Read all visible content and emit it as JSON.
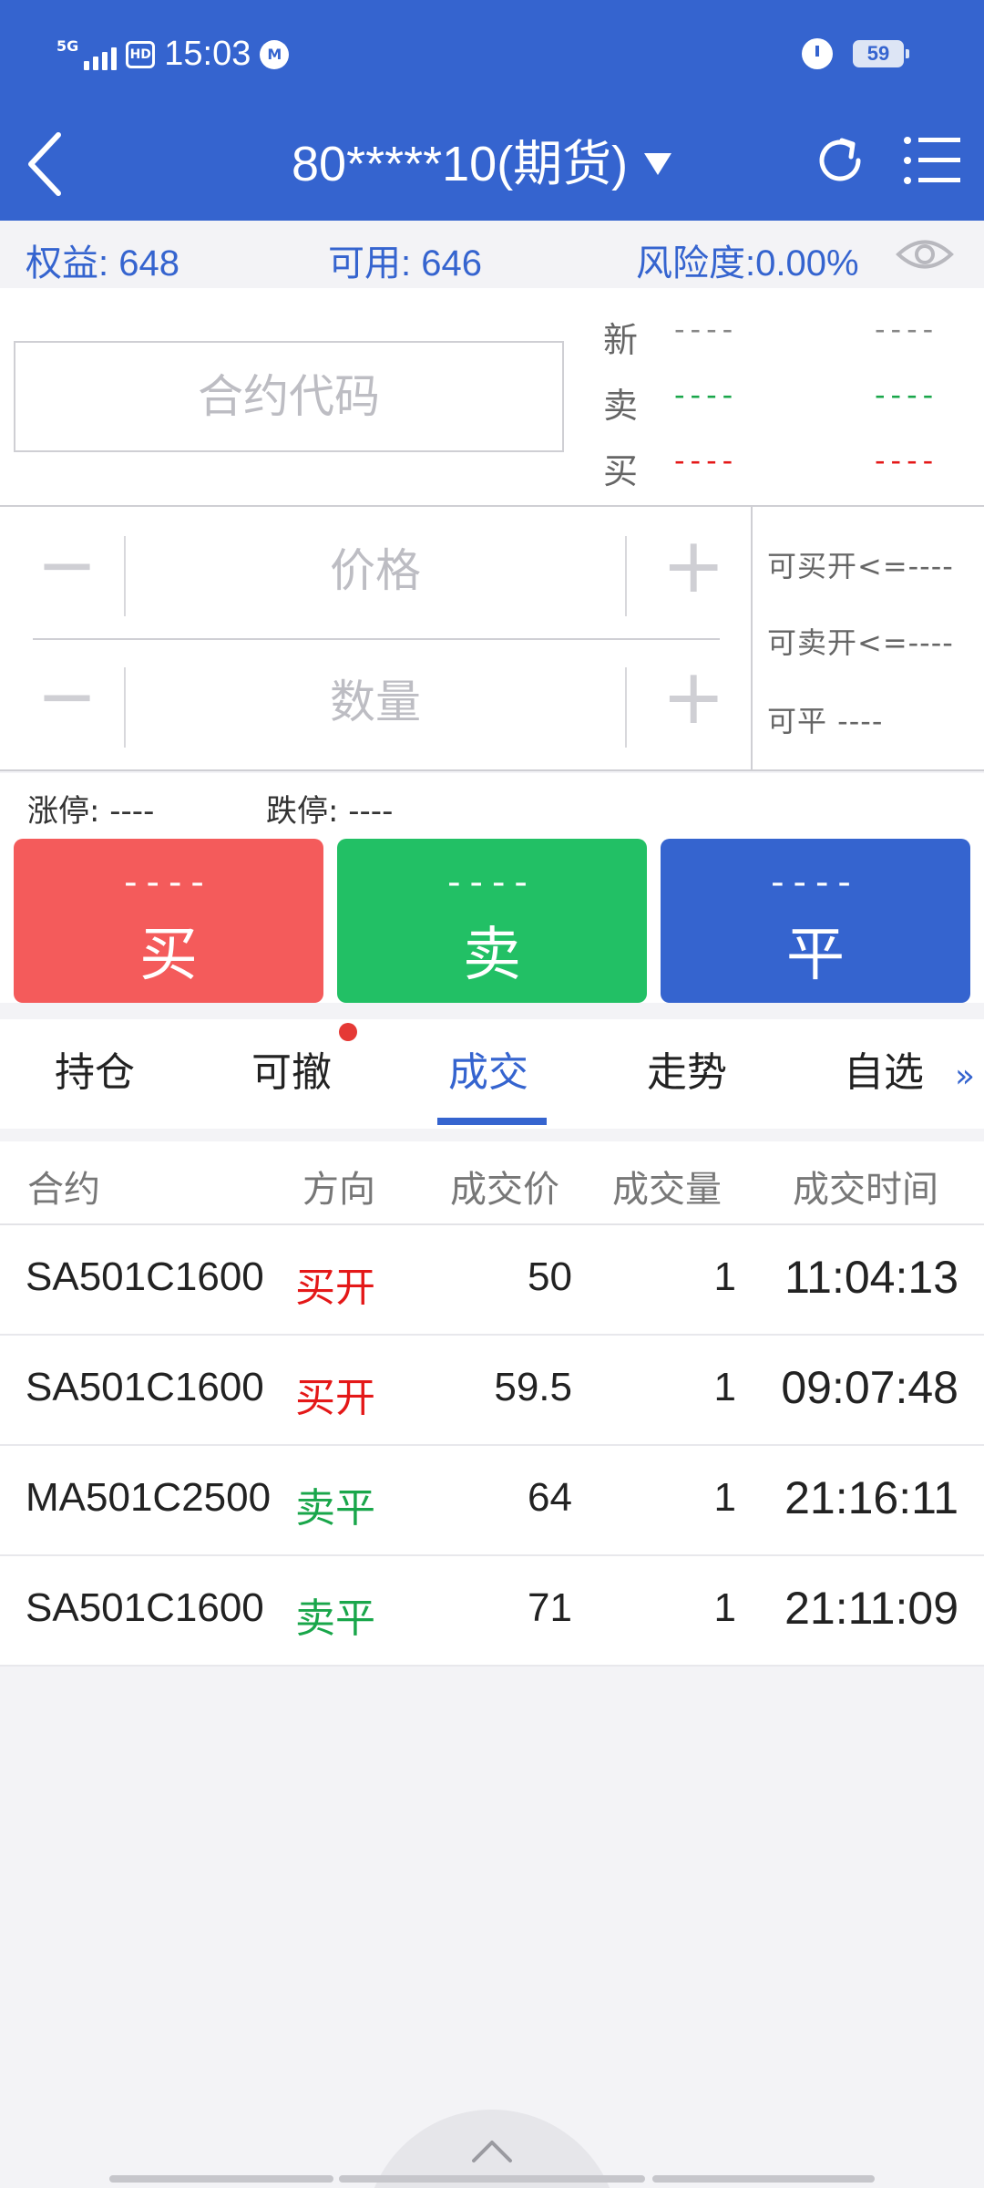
{
  "status_bar": {
    "network": "5G",
    "hd": "HD",
    "time": "15:03",
    "battery": "59"
  },
  "nav": {
    "account": "80*****10(期货)"
  },
  "account_bar": {
    "equity": "权益: 648",
    "available": "可用: 646",
    "risk": "风险度:0.00%"
  },
  "quote": {
    "contract_placeholder": "合约代码",
    "rows": [
      {
        "label": "新",
        "v1": "----",
        "v2": "----",
        "color": "#666666"
      },
      {
        "label": "卖",
        "v1": "----",
        "v2": "----",
        "color": "#19a64a"
      },
      {
        "label": "买",
        "v1": "----",
        "v2": "----",
        "color": "#e41818"
      }
    ]
  },
  "order": {
    "price_placeholder": "价格",
    "qty_placeholder": "数量",
    "can_buy_open": "可买开<=----",
    "can_sell_open": "可卖开<=----",
    "can_close": "可平  ----"
  },
  "limits": {
    "up": "涨停: ----",
    "down": "跌停: ----"
  },
  "trade_buttons": {
    "buy": {
      "price": "----",
      "label": "买"
    },
    "sell": {
      "price": "----",
      "label": "卖"
    },
    "close": {
      "price": "----",
      "label": "平"
    }
  },
  "tabs": [
    "持仓",
    "可撤",
    "成交",
    "走势",
    "自选"
  ],
  "active_tab": "成交",
  "table": {
    "headers": [
      "合约",
      "方向",
      "成交价",
      "成交量",
      "成交时间"
    ],
    "rows": [
      {
        "contract": "SA501C1600",
        "direction": "买开",
        "price": "50",
        "qty": "1",
        "time": "11:04:13"
      },
      {
        "contract": "SA501C1600",
        "direction": "买开",
        "price": "59.5",
        "qty": "1",
        "time": "09:07:48"
      },
      {
        "contract": "MA501C2500",
        "direction": "卖平",
        "price": "64",
        "qty": "1",
        "time": "21:16:11"
      },
      {
        "contract": "SA501C1600",
        "direction": "卖平",
        "price": "71",
        "qty": "1",
        "time": "21:11:09"
      }
    ]
  },
  "colors": {
    "brand": "#3564cf",
    "buy": "#f45b5b",
    "sell": "#22c065",
    "up_text": "#e41818",
    "down_text": "#19a64a"
  }
}
